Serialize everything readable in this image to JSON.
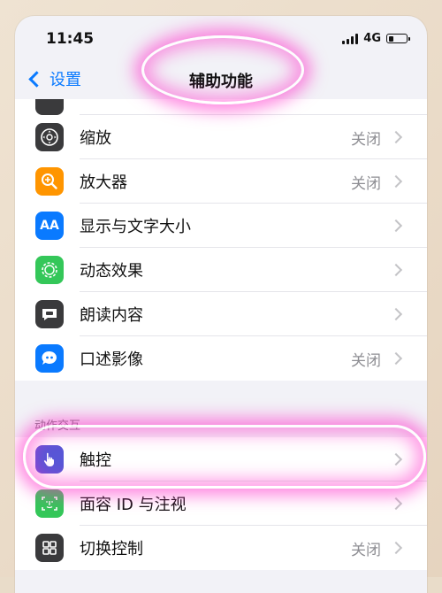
{
  "status": {
    "time": "11:45",
    "network": "4G"
  },
  "nav": {
    "back_label": "设置",
    "title": "辅助功能"
  },
  "rows_top": [
    {
      "label": "缩放",
      "value": "关闭",
      "icon": "zoom-icon",
      "color": "#3a3a3c"
    },
    {
      "label": "放大器",
      "value": "关闭",
      "icon": "magnifier-icon",
      "color": "#ff9500"
    },
    {
      "label": "显示与文字大小",
      "value": "",
      "icon": "text-size-icon",
      "color": "#0a7aff"
    },
    {
      "label": "动态效果",
      "value": "",
      "icon": "motion-icon",
      "color": "#34c759"
    },
    {
      "label": "朗读内容",
      "value": "",
      "icon": "speech-icon",
      "color": "#3a3a3c"
    },
    {
      "label": "口述影像",
      "value": "关闭",
      "icon": "audio-description-icon",
      "color": "#0a7aff"
    }
  ],
  "section": {
    "label": "动作交互"
  },
  "rows_bottom": [
    {
      "label": "触控",
      "value": "",
      "icon": "touch-hand-icon",
      "color": "#5856d6"
    },
    {
      "label": "面容 ID 与注视",
      "value": "",
      "icon": "face-id-icon",
      "color": "#34c759"
    },
    {
      "label": "切换控制",
      "value": "关闭",
      "icon": "switch-control-icon",
      "color": "#3a3a3c"
    }
  ],
  "icons": {
    "aa_text": "AA"
  }
}
